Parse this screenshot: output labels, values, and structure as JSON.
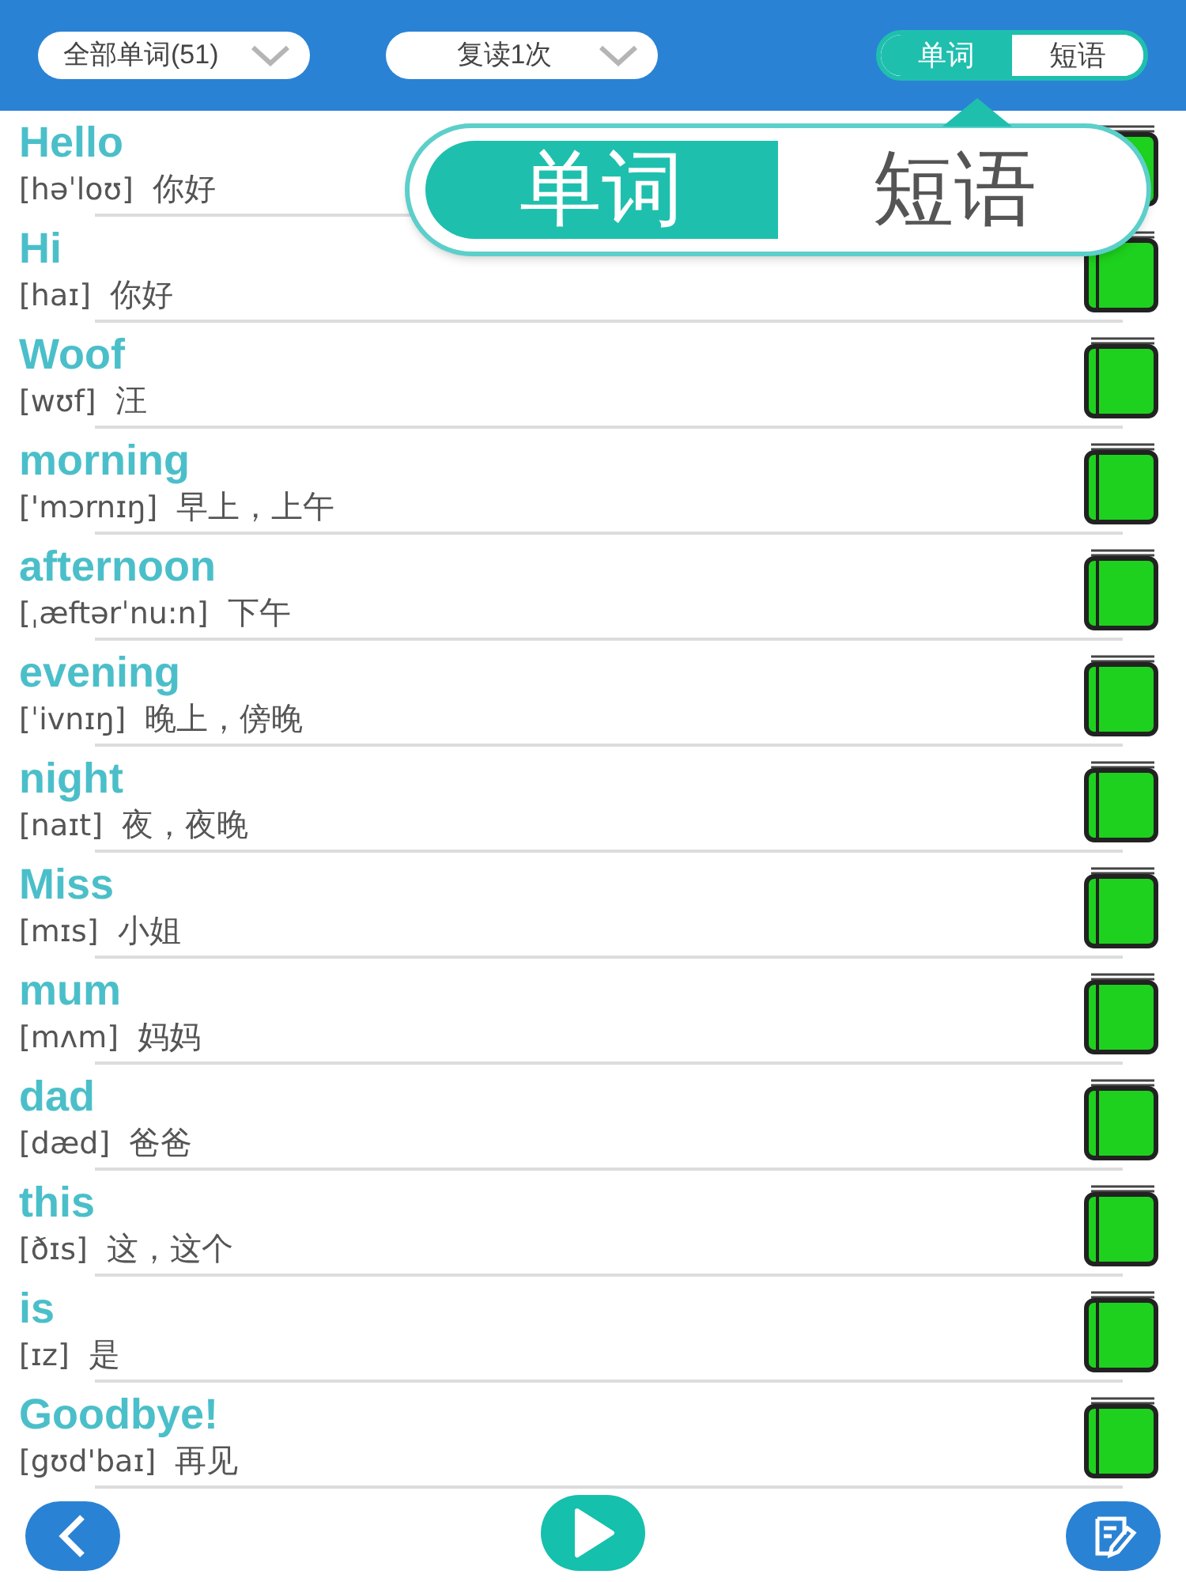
{
  "header": {
    "filters": [
      {
        "label": "全部单词(51)"
      },
      {
        "label": "复读1次"
      }
    ],
    "mode_toggle": [
      {
        "label": "单词",
        "selected": true
      },
      {
        "label": "短语",
        "selected": false
      }
    ]
  },
  "popup": {
    "options": [
      {
        "label": "单词",
        "selected": true
      },
      {
        "label": "短语",
        "selected": false
      }
    ]
  },
  "words": [
    {
      "word": "Hello",
      "phonetic": "[həˈloʊ]",
      "meaning": "你好"
    },
    {
      "word": "Hi",
      "phonetic": "[haɪ]",
      "meaning": "你好"
    },
    {
      "word": "Woof",
      "phonetic": "[wʊf]",
      "meaning": "汪"
    },
    {
      "word": "morning",
      "phonetic": "['mɔrnɪŋ]",
      "meaning": "早上，上午"
    },
    {
      "word": "afternoon",
      "phonetic": "[ˌæftərˈnu:n]",
      "meaning": "下午"
    },
    {
      "word": "evening",
      "phonetic": "[ˈivnɪŋ]",
      "meaning": "晚上，傍晚"
    },
    {
      "word": "night",
      "phonetic": "[naɪt]",
      "meaning": "夜，夜晚"
    },
    {
      "word": "Miss",
      "phonetic": "[mɪs]",
      "meaning": "小姐"
    },
    {
      "word": "mum",
      "phonetic": "[mʌm]",
      "meaning": "妈妈"
    },
    {
      "word": "dad",
      "phonetic": "[dæd]",
      "meaning": "爸爸"
    },
    {
      "word": "this",
      "phonetic": "[ðɪs]",
      "meaning": "这，这个"
    },
    {
      "word": "is",
      "phonetic": "[ɪz]",
      "meaning": "是"
    },
    {
      "word": "Goodbye!",
      "phonetic": "[gʊd'baɪ]",
      "meaning": "再见"
    }
  ]
}
